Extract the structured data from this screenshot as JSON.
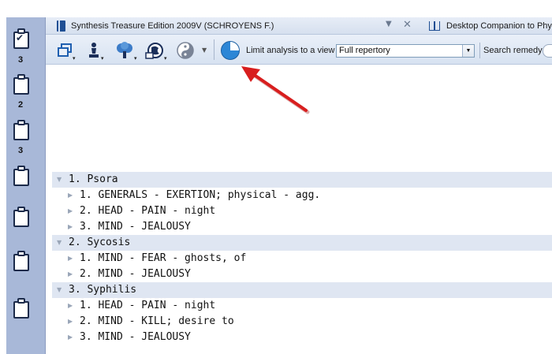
{
  "sidebar": {
    "clipboards": [
      {
        "count": "3",
        "checked": true
      },
      {
        "count": "2",
        "checked": false
      },
      {
        "count": "3",
        "checked": false
      },
      {
        "count": "",
        "checked": false
      },
      {
        "count": "",
        "checked": false
      },
      {
        "count": "",
        "checked": false
      },
      {
        "count": "",
        "checked": false
      }
    ]
  },
  "tabs": {
    "active_title": "Synthesis Treasure Edition 2009V (SCHROYENS F.)",
    "menu_glyph": "▼",
    "close_glyph": "✕",
    "second_title": "Desktop Companion to Physical Pathology"
  },
  "toolbar": {
    "limit_label": "Limit analysis to a view",
    "view_value": "Full repertory",
    "search_label": "Search remedy:",
    "icons": [
      "windows-icon",
      "chess-pawn-icon",
      "tree-icon",
      "globe-book-icon",
      "yin-yang-icon",
      "pie-chart-icon"
    ]
  },
  "tree": {
    "groups": [
      {
        "label": "1. Psora",
        "items": [
          "1. GENERALS - EXERTION; physical - agg.",
          "2. HEAD - PAIN - night",
          "3. MIND - JEALOUSY"
        ]
      },
      {
        "label": "2. Sycosis",
        "items": [
          "1. MIND - FEAR - ghosts, of",
          "2. MIND - JEALOUSY"
        ]
      },
      {
        "label": "3. Syphilis",
        "items": [
          "1. HEAD - PAIN - night",
          "2. MIND - KILL; desire to",
          "3. MIND - JEALOUSY"
        ]
      }
    ]
  },
  "colors": {
    "sidebar": "#a8b8d8",
    "toolbar": "#d7e2f1",
    "group_row": "#dfe6f2",
    "arrow": "#d81e1e",
    "pie_accent": "#2c86d6"
  }
}
